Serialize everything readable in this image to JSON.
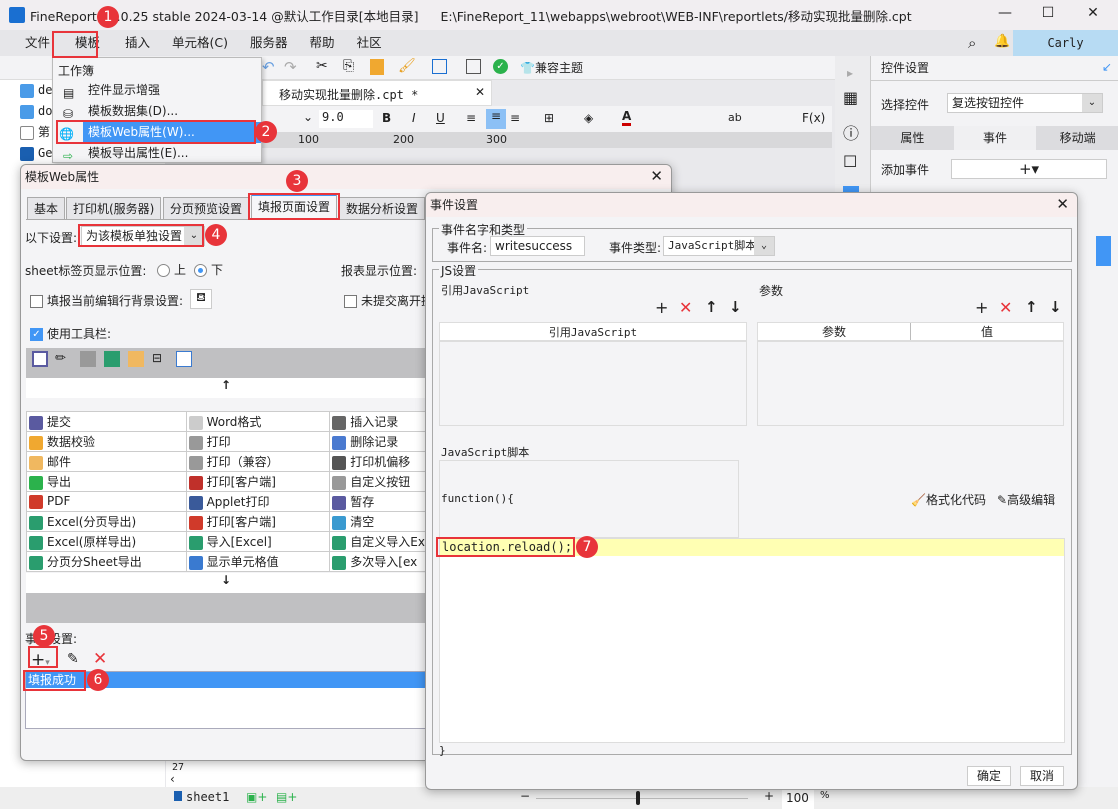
{
  "window": {
    "title": "FineReport 11.0.25 stable 2024-03-14 @默认工作目录[本地目录]",
    "path": "E:\\FineReport_11\\webapps\\webroot\\WEB-INF\\reportlets/移动实现批量删除.cpt",
    "min": "—",
    "max": "☐",
    "close": "✕"
  },
  "menu": {
    "items": [
      "文件",
      "模板",
      "插入",
      "单元格(C)",
      "服务器",
      "帮助",
      "社区"
    ],
    "user": "Carly"
  },
  "toolbar": {
    "compat_theme": "兼容主题",
    "doc_tab": "移动实现批量删除.cpt *",
    "font_size": "9.0",
    "ruler": [
      "100",
      "200",
      "300"
    ]
  },
  "tree": {
    "items": [
      "de",
      "do",
      "第",
      "Ge",
      "UR"
    ]
  },
  "dropdown": {
    "section": "工作簿",
    "items": [
      "控件显示增强",
      "模板数据集(D)...",
      "模板Web属性(W)...",
      "模板导出属性(E)..."
    ]
  },
  "right_panel": {
    "title": "控件设置",
    "select_label": "选择控件",
    "select_value": "复选按钮控件",
    "tabs": [
      "属性",
      "事件",
      "移动端"
    ],
    "add_event": "添加事件",
    "add_symbol": "+▾"
  },
  "web_dialog": {
    "title": "模板Web属性",
    "tabs": [
      "基本",
      "打印机(服务器)",
      "分页预览设置",
      "填报页面设置",
      "数据分析设置"
    ],
    "setting_label": "以下设置:",
    "setting_value": "为该模板单独设置",
    "sheet_pos_label": "sheet标签页显示位置:",
    "radio_top": "上",
    "radio_bottom": "下",
    "report_pos_label": "报表显示位置:",
    "bg_setting": "填报当前编辑行背景设置:",
    "unsubmit": "未提交离开提",
    "use_toolbar": "使用工具栏:",
    "buttons": [
      [
        "提交",
        "Word格式",
        "插入记录"
      ],
      [
        "数据校验",
        "打印",
        "删除记录"
      ],
      [
        "邮件",
        "打印（兼容）",
        "打印机偏移"
      ],
      [
        "导出",
        "打印[客户端]",
        "自定义按钮"
      ],
      [
        "PDF",
        "Applet打印",
        "暂存"
      ],
      [
        "Excel(分页导出)",
        "打印[客户端]",
        "清空"
      ],
      [
        "Excel(原样导出)",
        "导入[Excel]",
        "自定义导入Ex"
      ],
      [
        "分页分Sheet导出",
        "显示单元格值",
        "多次导入[ex"
      ]
    ],
    "event_label": "事件设置:",
    "event_item": "填报成功",
    "up": "↑",
    "down": "↓"
  },
  "event_dialog": {
    "title": "事件设置",
    "group1": "事件名字和类型",
    "name_label": "事件名:",
    "name_value": "writesuccess",
    "type_label": "事件类型:",
    "type_value": "JavaScript脚本",
    "js_group": "JS设置",
    "ref_js": "引用JavaScript",
    "params": "参数",
    "col_ref": "引用JavaScript",
    "col_param": "参数",
    "col_value": "值",
    "script_label": "JavaScript脚本",
    "func_head": "function(){",
    "format_code": "格式化代码",
    "advanced_edit": "高级编辑",
    "code": "location.reload();",
    "func_end": "}",
    "ok": "确定",
    "cancel": "取消"
  },
  "status": {
    "sheet": "sheet1",
    "zoom": "100",
    "pct": "%",
    "row": "27"
  },
  "badges": [
    "1",
    "2",
    "3",
    "4",
    "5",
    "6",
    "7"
  ],
  "colors": {
    "accent": "#4196f5",
    "annotation": "#e8343a",
    "code_highlight": "#ffffb3"
  }
}
